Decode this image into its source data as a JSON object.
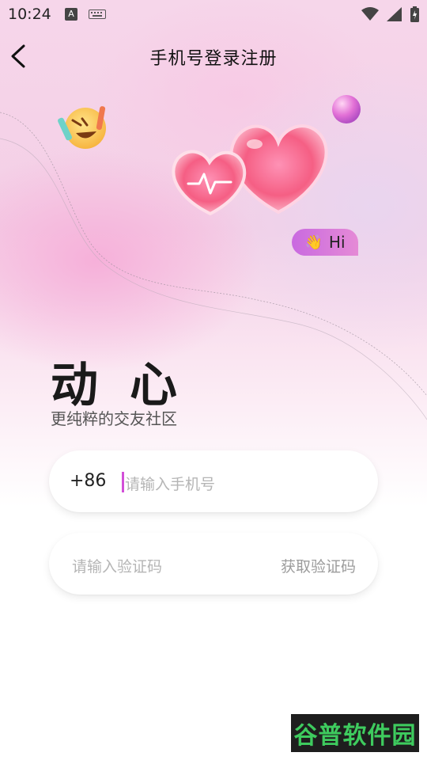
{
  "status_bar": {
    "time": "10:24",
    "notification_icon_letter": "A",
    "icons": [
      "wifi-icon",
      "signal-icon",
      "battery-charging-icon"
    ]
  },
  "header": {
    "title": "手机号登录注册",
    "back_icon": "chevron-left-icon"
  },
  "decor": {
    "badge_text": "Hi",
    "badge_emoji": "👋",
    "accent": "#d24fd8"
  },
  "brand": {
    "name": "动心",
    "slogan": "更纯粹的交友社区"
  },
  "form": {
    "country_code": "+86",
    "phone_placeholder": "请输入手机号",
    "code_placeholder": "请输入验证码",
    "get_code_label": "获取验证码"
  },
  "watermark": {
    "text": "谷普软件园"
  }
}
